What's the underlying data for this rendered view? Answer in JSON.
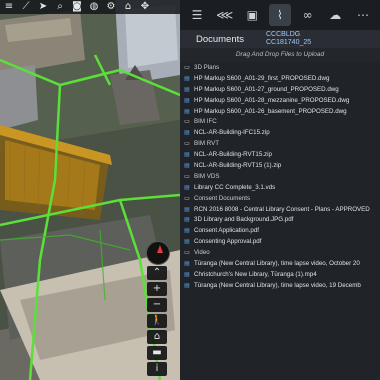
{
  "toolbar": {
    "icons": [
      "layers-icon",
      "ruler-icon",
      "cursor-icon",
      "search-icon",
      "camera-icon",
      "globe-icon",
      "gear-icon",
      "home-icon",
      "move-icon"
    ]
  },
  "map_controls": {
    "zoom_in": "+",
    "zoom_out": "−"
  },
  "panel": {
    "tabs": [
      "list-icon",
      "share-icon",
      "image-icon",
      "attachment-icon",
      "link-icon",
      "chat-icon",
      "more-icon"
    ],
    "header_tab": "Documents",
    "project_code": "CCCBLDG",
    "project_sub": "CC181740_25",
    "drop_hint": "Drag And Drop Files to Upload",
    "items": [
      {
        "type": "folder",
        "label": "3D Plans"
      },
      {
        "type": "file",
        "label": "HP Markup S600_A01-29_first_PROPOSED.dwg"
      },
      {
        "type": "file",
        "label": "HP Markup S600_A01-27_ground_PROPOSED.dwg"
      },
      {
        "type": "file",
        "label": "HP Markup S600_A01-28_mezzanine_PROPOSED.dwg"
      },
      {
        "type": "file",
        "label": "HP Markup S600_A01-26_basement_PROPOSED.dwg"
      },
      {
        "type": "folder",
        "label": "BIM IFC"
      },
      {
        "type": "file",
        "label": "NCL-AR-Building-IFC15.zip"
      },
      {
        "type": "folder",
        "label": "BIM RVT"
      },
      {
        "type": "file",
        "label": "NCL-AR-Building-RVT15.zip"
      },
      {
        "type": "file",
        "label": "NCL-AR-Building-RVT15 (1).zip"
      },
      {
        "type": "folder",
        "label": "BIM VDS"
      },
      {
        "type": "file",
        "label": "Library CC Complete_3.1.vds"
      },
      {
        "type": "folder",
        "label": "Consent Documents"
      },
      {
        "type": "file",
        "label": "RCN 2016 8008 - Central Library Consent - Plans - APPROVED"
      },
      {
        "type": "file",
        "label": "3D Library and Background.JPG.pdf"
      },
      {
        "type": "file",
        "label": "Consent Application.pdf"
      },
      {
        "type": "file",
        "label": "Consenting Approval.pdf"
      },
      {
        "type": "folder",
        "label": "Video"
      },
      {
        "type": "file",
        "label": "Tūranga (New Central Library), time lapse video, October 20"
      },
      {
        "type": "file",
        "label": "Christchurch's New Library, Tūranga (1).mp4"
      },
      {
        "type": "file",
        "label": "Tūranga (New Central Library), time lapse video, 19 Decemb"
      }
    ]
  }
}
